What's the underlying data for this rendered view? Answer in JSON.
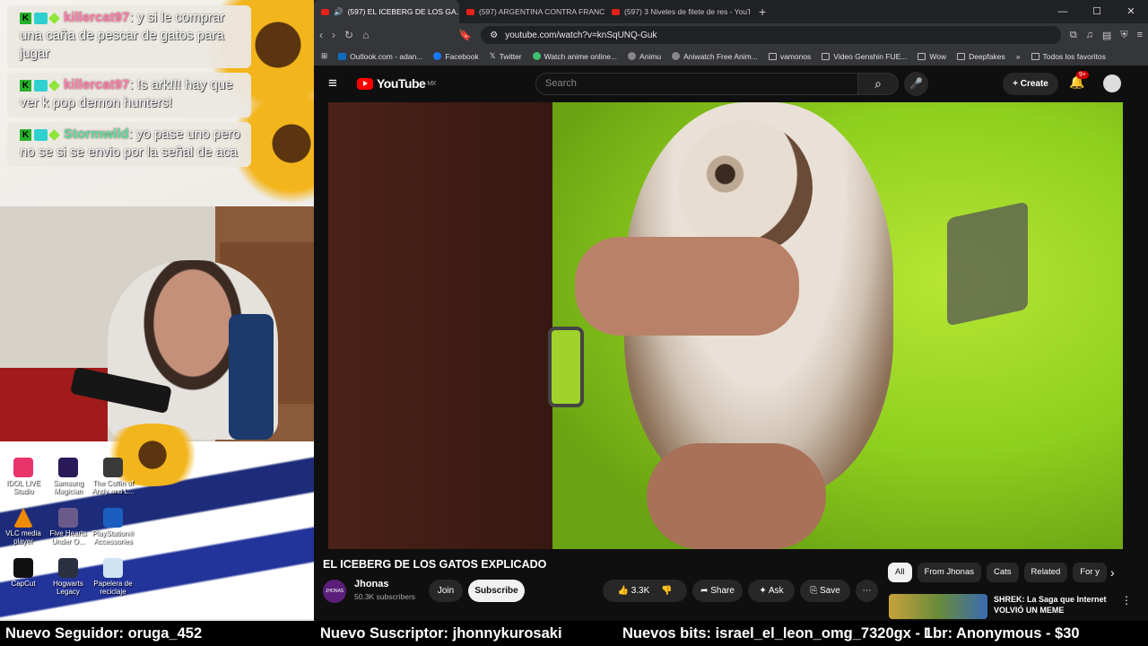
{
  "chat": [
    {
      "user": "killercat97",
      "text": ": y si le comprar una caña de pescar de gatos para jugar",
      "color": "pink"
    },
    {
      "user": "killercat97",
      "text": ": !s ark!!! hay que ver k pop demon hunters!",
      "color": "pink"
    },
    {
      "user": "Stormwild",
      "text": ": yo pase uno pero no se si se envio por la señal de aca",
      "color": "green"
    }
  ],
  "desktop_icons": [
    {
      "label": "IDOL LIVE Studio",
      "icon": "app-icon"
    },
    {
      "label": "Samsung Magician",
      "icon": "app-icon"
    },
    {
      "label": "The Coffin of Andy and L...",
      "icon": "app-icon"
    },
    {
      "label": "VLC media player",
      "icon": "vlc-icon"
    },
    {
      "label": "Five Hearts Under O...",
      "icon": "app-icon"
    },
    {
      "label": "PlayStation® Accessories",
      "icon": "playstation-icon"
    },
    {
      "label": "CapCut",
      "icon": "capcut-icon"
    },
    {
      "label": "Hogwarts Legacy",
      "icon": "app-icon"
    },
    {
      "label": "Papelera de reciclaje",
      "icon": "recycle-bin-icon"
    }
  ],
  "browser": {
    "tabs": [
      {
        "title": "(597) EL ICEBERG DE LOS GA...",
        "active": true
      },
      {
        "title": "(597) ARGENTINA CONTRA FRANCIA",
        "active": false
      },
      {
        "title": "(597) 3 Niveles de filete de res - YouT",
        "active": false
      }
    ],
    "url": "youtube.com/watch?v=knSqUNQ-Guk",
    "bookmarks": [
      "Outlook.com - adan...",
      "Facebook",
      "Twitter",
      "Watch anime online...",
      "Animu",
      "Aniwatch Free Anim...",
      "vamonos",
      "Video Genshin FUE...",
      "Wow",
      "Deepfakes"
    ],
    "all_bookmarks": "Todos los favoritos"
  },
  "youtube": {
    "logo": "YouTube",
    "region": "MX",
    "search_placeholder": "Search",
    "create": "Create",
    "notifications": "9+",
    "video_title": "EL ICEBERG DE LOS GATOS EXPLICADO",
    "channel": "Jhonas",
    "channel_avatar_text": "JHONAS",
    "subscribers": "50.3K subscribers",
    "join": "Join",
    "subscribe": "Subscribe",
    "likes": "3.3K",
    "share": "Share",
    "ask": "Ask",
    "save": "Save",
    "filters": [
      "All",
      "From Jhonas",
      "Cats",
      "Related",
      "For y"
    ],
    "rec_title": "SHREK: La Saga que Internet VOLVIÓ UN MEME"
  },
  "ticker": {
    "follower": "Nuevo Seguidor: oruga_452",
    "subscriber": "Nuevo Suscriptor: jhonnykurosaki",
    "bits": "Nuevos bits: israel_el_leon_omg_7320gx - 1",
    "donor": "Lbr: Anonymous - $30"
  }
}
